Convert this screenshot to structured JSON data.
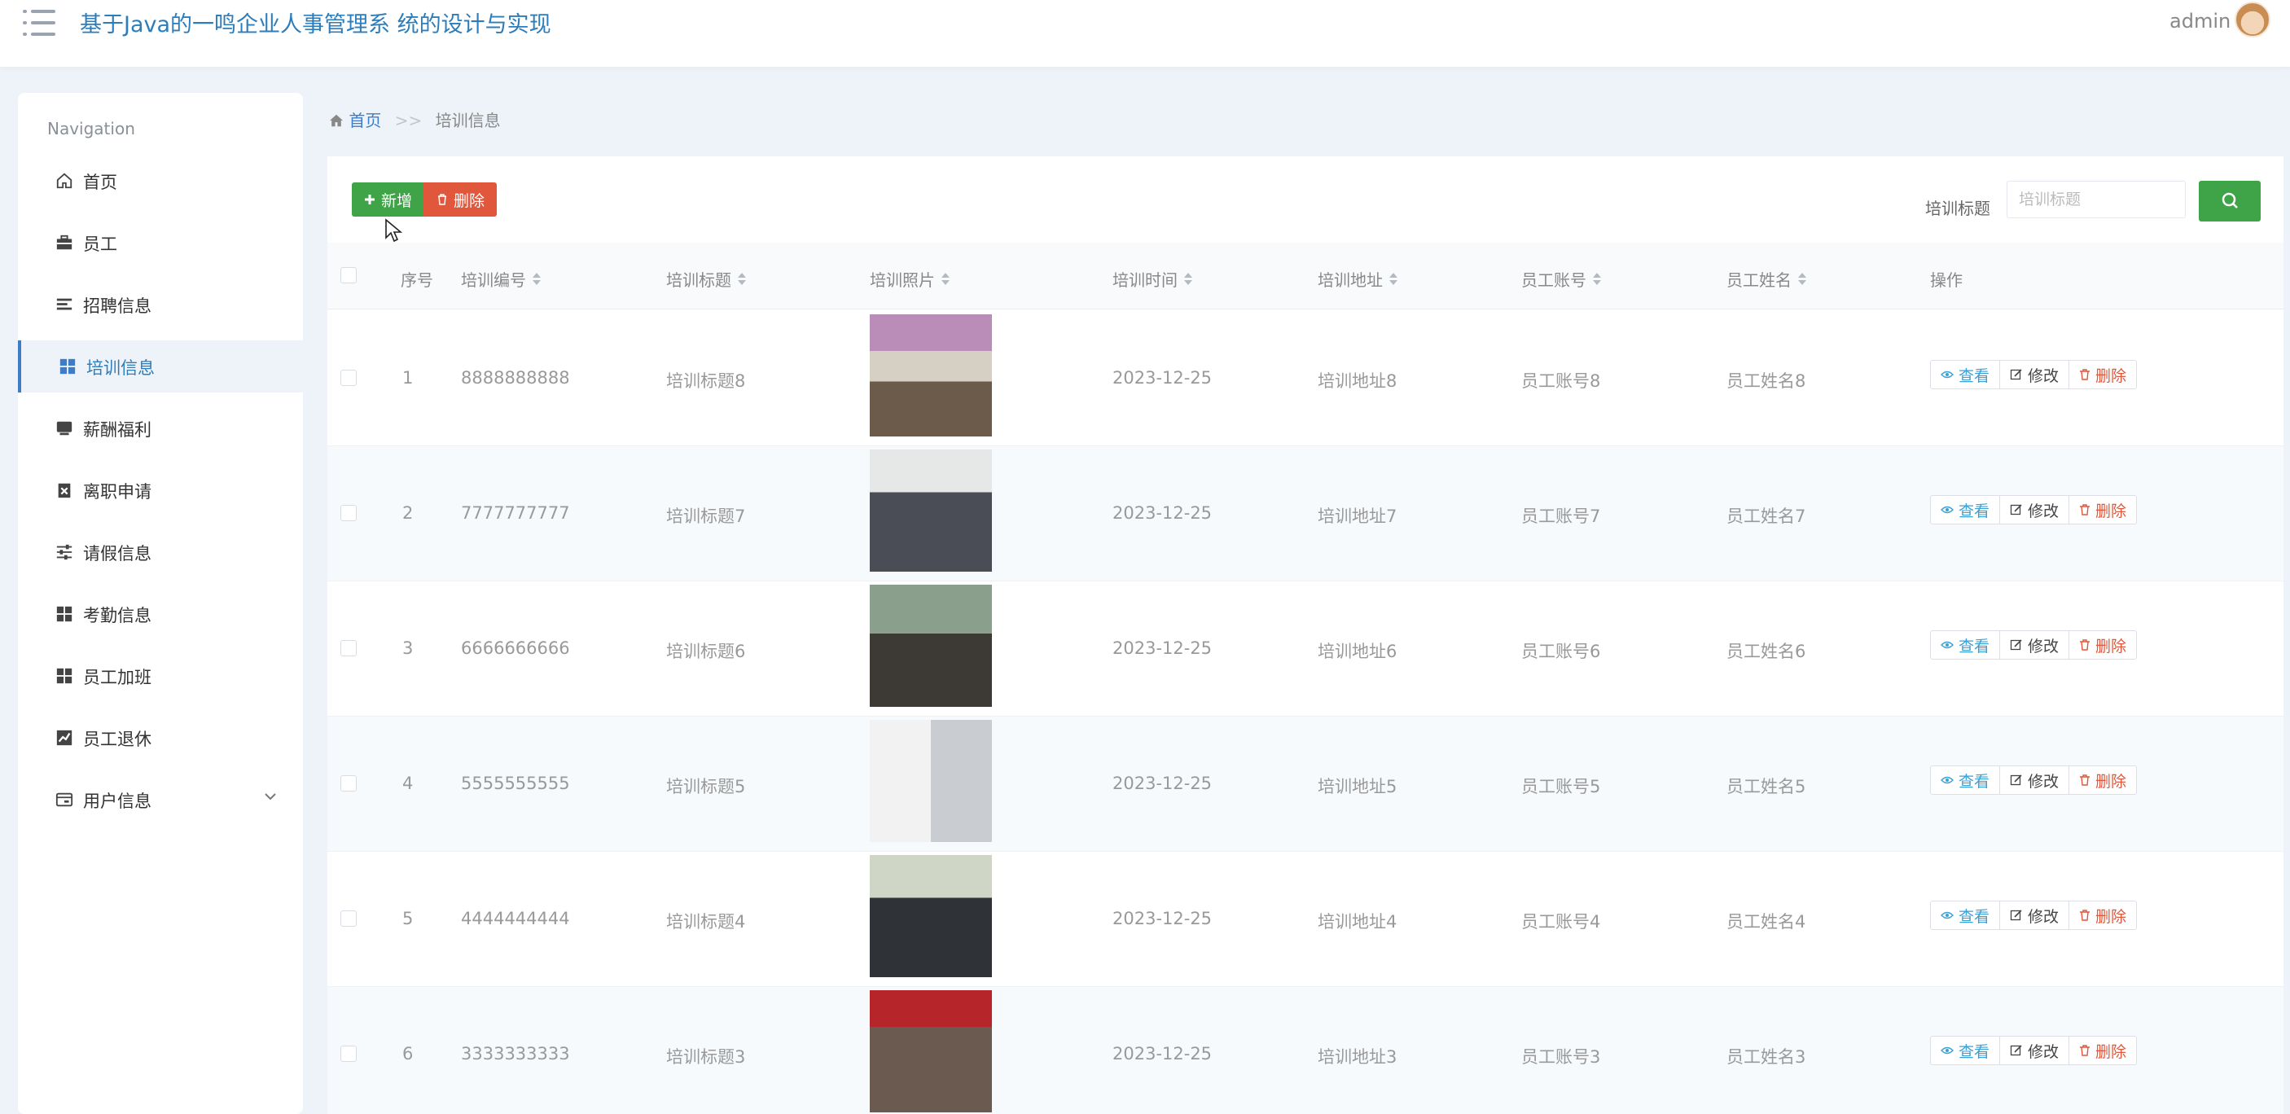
{
  "header": {
    "title": "基于Java的一鸣企业人事管理系 统的设计与实现",
    "user": "admin"
  },
  "sidebar": {
    "heading": "Navigation",
    "items": [
      {
        "label": "首页",
        "icon": "home-icon"
      },
      {
        "label": "员工",
        "icon": "briefcase-icon"
      },
      {
        "label": "招聘信息",
        "icon": "list-icon"
      },
      {
        "label": "培训信息",
        "icon": "grid-icon",
        "active": true
      },
      {
        "label": "薪酬福利",
        "icon": "inbox-icon"
      },
      {
        "label": "离职申请",
        "icon": "clipboard-icon"
      },
      {
        "label": "请假信息",
        "icon": "sliders-icon"
      },
      {
        "label": "考勤信息",
        "icon": "grid-icon"
      },
      {
        "label": "员工加班",
        "icon": "grid-icon"
      },
      {
        "label": "员工退休",
        "icon": "chart-icon"
      },
      {
        "label": "用户信息",
        "icon": "window-icon",
        "expandable": true
      }
    ]
  },
  "breadcrumb": {
    "home": "首页",
    "separator": ">>",
    "current": "培训信息"
  },
  "toolbar": {
    "add_label": "新增",
    "delete_label": "删除",
    "search_label": "培训标题",
    "search_placeholder": "培训标题",
    "search_value": ""
  },
  "table": {
    "columns": [
      "序号",
      "培训编号",
      "培训标题",
      "培训照片",
      "培训时间",
      "培训地址",
      "员工账号",
      "员工姓名",
      "操作"
    ],
    "rows": [
      {
        "index": "1",
        "code": "8888888888",
        "title": "培训标题8",
        "time": "2023-12-25",
        "address": "培训地址8",
        "account": "员工账号8",
        "name": "员工姓名8"
      },
      {
        "index": "2",
        "code": "7777777777",
        "title": "培训标题7",
        "time": "2023-12-25",
        "address": "培训地址7",
        "account": "员工账号7",
        "name": "员工姓名7"
      },
      {
        "index": "3",
        "code": "6666666666",
        "title": "培训标题6",
        "time": "2023-12-25",
        "address": "培训地址6",
        "account": "员工账号6",
        "name": "员工姓名6"
      },
      {
        "index": "4",
        "code": "5555555555",
        "title": "培训标题5",
        "time": "2023-12-25",
        "address": "培训地址5",
        "account": "员工账号5",
        "name": "员工姓名5"
      },
      {
        "index": "5",
        "code": "4444444444",
        "title": "培训标题4",
        "time": "2023-12-25",
        "address": "培训地址4",
        "account": "员工账号4",
        "name": "员工姓名4"
      },
      {
        "index": "6",
        "code": "3333333333",
        "title": "培训标题3",
        "time": "2023-12-25",
        "address": "培训地址3",
        "account": "员工账号3",
        "name": "员工姓名3"
      }
    ],
    "actions": {
      "view": "查看",
      "edit": "修改",
      "delete": "删除"
    }
  },
  "colors": {
    "accent": "#2d7dba",
    "add": "#3fa447",
    "delete": "#e0573c",
    "view": "#3aa0d8"
  }
}
